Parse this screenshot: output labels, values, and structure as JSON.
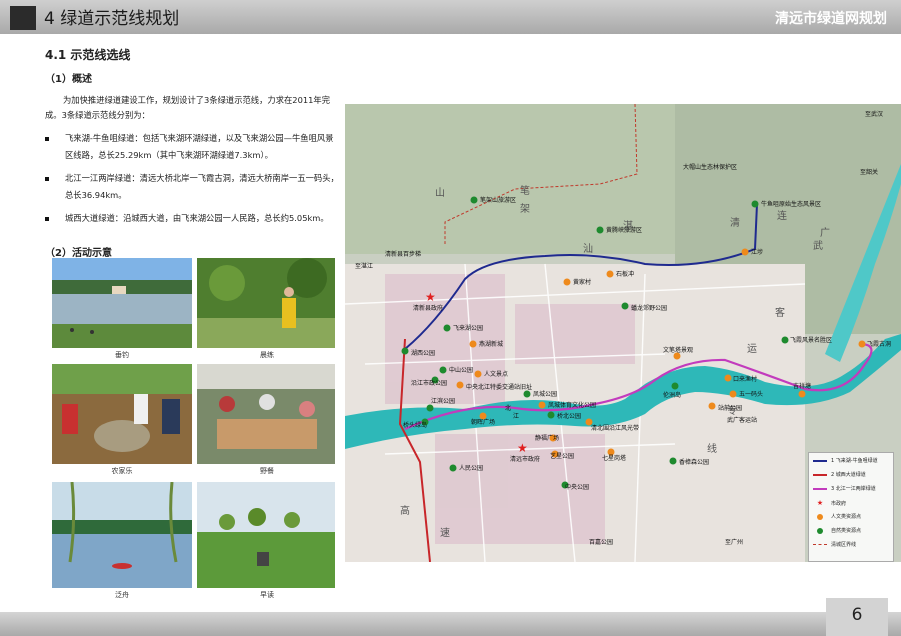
{
  "header": {
    "section_number": "4",
    "section_title": "绿道示范线规划",
    "project_title": "清远市绿道网规划"
  },
  "content": {
    "heading": "4.1 示范线选线",
    "overview_heading": "（1）概述",
    "intro": "为加快推进绿道建设工作，规划设计了3条绿道示范线，力求在2011年完成。3条绿道示范线分别为：",
    "bullets": [
      "飞来湖-牛鱼咀绿道：包括飞来湖环湖绿道，以及飞来湖公园—牛鱼咀风景区线路，总长25.29km（其中飞来湖环湖绿道7.3km）。",
      "北江一江两岸绿道：清远大桥北岸一飞霞古洞，清远大桥南岸一五一码头，总长36.94km。",
      "城西大道绿道：沿城西大道，由飞来湖公园一人民路，总长约5.05km。"
    ],
    "activity_heading": "（2）活动示意"
  },
  "photos": {
    "captions": [
      "垂钓",
      "晨练",
      "农家乐",
      "野餐",
      "泛舟",
      "早读"
    ]
  },
  "map": {
    "region_labels": [
      "笔",
      "架",
      "山",
      "汕",
      "湛",
      "高",
      "速",
      "清",
      "连",
      "广",
      "武",
      "客",
      "运",
      "专",
      "线",
      "北",
      "江",
      "至湛江",
      "至武汉",
      "至韶关",
      "至广州"
    ],
    "place_labels": [
      "笔架山旅游区",
      "大帽山生态林保护区",
      "牛鱼咀原始生态风景区",
      "黄腾峡旅游区",
      "江埗",
      "石板冲",
      "黄家村",
      "清新县百步梯",
      "清新县政府",
      "飞来湖公园",
      "燕湖新城",
      "湖西公园",
      "中山公园",
      "人文景点",
      "沿江市政公园",
      "中央北江特委交通站旧址",
      "凤城公园",
      "凤城体育文化公园",
      "桥北公园",
      "江滨公园",
      "朝晖广场",
      "桥头绿岛",
      "清远市政府",
      "静福广场",
      "艺星公园",
      "清北围沿江风光带",
      "七星岗塔",
      "人民公园",
      "中央公园",
      "文笔塔景观",
      "伦洲岛",
      "口来渔村",
      "五一码头",
      "站前公园",
      "武广客运站",
      "吉祥塘",
      "飞霞风景名胜区",
      "飞霞古洞",
      "香樟森公园",
      "百嘉公园",
      "蟠龙郊野公园"
    ],
    "colors": {
      "route1": "#1f2a8f",
      "route2": "#c8262a",
      "route3": "#c23bbd",
      "river": "#2eb8b8",
      "cultural_dot": "#ee8a1c",
      "natural_dot": "#1e8a2e",
      "boundary": "#c0392b"
    }
  },
  "legend": {
    "items": [
      "1 飞来湖-牛鱼咀绿道",
      "2 城西大道绿道",
      "3 北江一江两岸绿道",
      "市政府",
      "人文类资源点",
      "自然类资源点",
      "清城区界线"
    ]
  },
  "footer": {
    "page_number": "6"
  }
}
